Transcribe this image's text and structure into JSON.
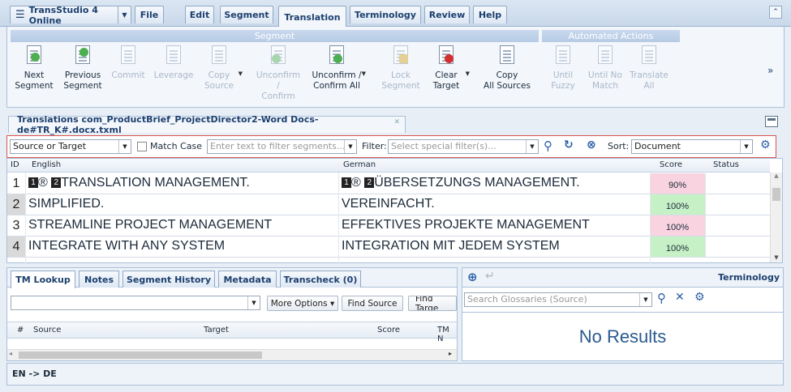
{
  "menubar": {
    "app_menu": "TransStudio 4 Online",
    "tabs": [
      "File",
      "Edit",
      "Segment",
      "Translation",
      "Terminology",
      "Review",
      "Help"
    ],
    "active_tab": "Translation"
  },
  "ribbon": {
    "segment_group": "Segment",
    "automated_group": "Automated Actions",
    "buttons": [
      {
        "line1": "Next",
        "line2": "Segment"
      },
      {
        "line1": "Previous",
        "line2": "Segment"
      },
      {
        "line1": "Commit",
        "line2": ""
      },
      {
        "line1": "Leverage",
        "line2": ""
      },
      {
        "line1": "Copy",
        "line2": "Source"
      },
      {
        "line1": "Unconfirm /",
        "line2": "Confirm"
      },
      {
        "line1": "Unconfirm /",
        "line2": "Confirm All"
      },
      {
        "line1": "Lock",
        "line2": "Segment"
      },
      {
        "line1": "Clear",
        "line2": "Target"
      },
      {
        "line1": "Copy",
        "line2": "All Sources"
      },
      {
        "line1": "Until",
        "line2": "Fuzzy"
      },
      {
        "line1": "Until No",
        "line2": "Match"
      },
      {
        "line1": "Translate",
        "line2": "All"
      }
    ],
    "more": "»"
  },
  "document_tab": {
    "title": "Translations com_ProductBrief_ProjectDirector2-Word Docs-de#TR_K#.docx.txml"
  },
  "filter": {
    "scope": "Source or Target",
    "match_case": "Match Case",
    "search_placeholder": "Enter text to filter segments...",
    "filter_label": "Filter:",
    "filter_placeholder": "Select special filter(s)...",
    "sort_label": "Sort:",
    "sort_value": "Document"
  },
  "grid": {
    "headers": {
      "id": "ID",
      "source": "English",
      "target": "German",
      "score": "Score",
      "status": "Status"
    },
    "rows": [
      {
        "id": "1",
        "source": "TRANSLATION MANAGEMENT.",
        "target": "ÜBERSETZUNGS MANAGEMENT.",
        "score": "90%",
        "score_color": "#f9d3df",
        "tagged": true
      },
      {
        "id": "2",
        "source": "SIMPLIFIED.",
        "target": "VEREINFACHT.",
        "score": "100%",
        "score_color": "#c6f0c6",
        "tagged": false
      },
      {
        "id": "3",
        "source": "STREAMLINE PROJECT MANAGEMENT",
        "target": "EFFEKTIVES PROJEKTE MANAGEMENT",
        "score": "100%",
        "score_color": "#f9d3df",
        "tagged": false
      },
      {
        "id": "4",
        "source": "INTEGRATE WITH ANY SYSTEM",
        "target": "INTEGRATION MIT JEDEM SYSTEM",
        "score": "100%",
        "score_color": "#c6f0c6",
        "tagged": false
      }
    ],
    "tag_prefix": "®"
  },
  "lookup": {
    "tabs": [
      "TM Lookup",
      "Notes",
      "Segment History",
      "Metadata",
      "Transcheck (0)"
    ],
    "more_options": "More Options ▾",
    "find_source": "Find Source",
    "find_target": "Find Targe",
    "columns": {
      "num": "#",
      "source": "Source",
      "target": "Target",
      "score": "Score",
      "tm": "TM N"
    }
  },
  "terminology": {
    "title": "Terminology",
    "search_placeholder": "Search Glossaries (Source)",
    "no_results": "No Results"
  },
  "status": {
    "lang_pair": "EN -> DE"
  }
}
